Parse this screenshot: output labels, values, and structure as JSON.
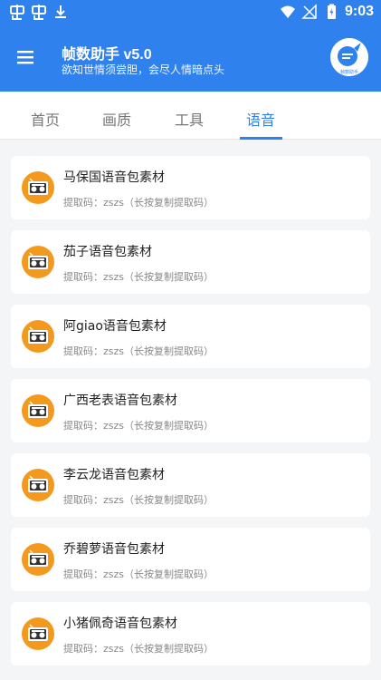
{
  "status_bar": {
    "time": "9:03"
  },
  "app": {
    "title": "帧数助手 v5.0",
    "subtitle": "欲知世情须尝胆，会尽人情暗点头",
    "logo_text": "帧数助手"
  },
  "tabs": [
    {
      "label": "首页"
    },
    {
      "label": "画质"
    },
    {
      "label": "工具"
    },
    {
      "label": "语音"
    }
  ],
  "active_tab": "语音",
  "items": [
    {
      "title": "马保国语音包素材",
      "subtitle": "提取码：zszs（长按复制提取码）"
    },
    {
      "title": "茄子语音包素材",
      "subtitle": "提取码：zszs（长按复制提取码）"
    },
    {
      "title": "阿giao语音包素材",
      "subtitle": "提取码：zszs（长按复制提取码）"
    },
    {
      "title": "广西老表语音包素材",
      "subtitle": "提取码：zszs（长按复制提取码）"
    },
    {
      "title": "李云龙语音包素材",
      "subtitle": "提取码：zszs（长按复制提取码）"
    },
    {
      "title": "乔碧萝语音包素材",
      "subtitle": "提取码：zszs（长按复制提取码）"
    },
    {
      "title": "小猪佩奇语音包素材",
      "subtitle": "提取码：zszs（长按复制提取码）"
    }
  ],
  "colors": {
    "primary": "#2f82ee",
    "icon_orange": "#f39a1e",
    "background": "#f4f5f7"
  }
}
